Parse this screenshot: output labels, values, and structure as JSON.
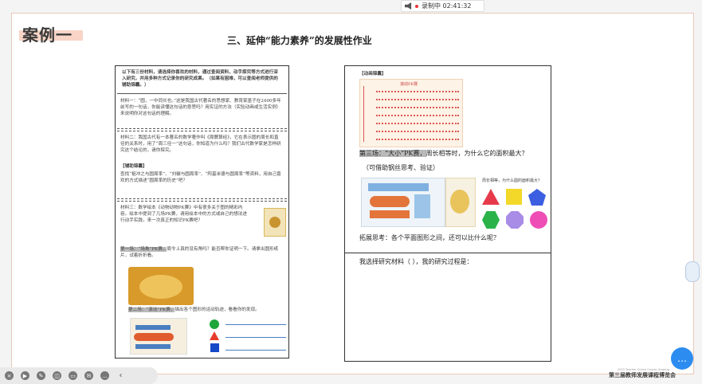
{
  "recording": {
    "label": "录制中 02:41:32"
  },
  "slide": {
    "case_title": "案例一",
    "title": "三、延伸“能力素养”的发展性作业"
  },
  "left_doc": {
    "intro": "以下有三份材料，请选择你喜欢的材料，通过查阅资料，动手探究等方式进行深入研究，并用多种方式记录你的研究成果。（如果有困难，可以查阅老师提供的辅助锦囊。）",
    "m1": "材料一：“圆，一中同长也。”这是我国古代著名的思想家、教育家墨子在2400多年前写的一句话，你能读懂这句话的意思吗？用实证的方法（实验动画或生活实例）来说明你对这句话的理解。",
    "m2": "材料二：我国古代有一本著名的数学著作叫《周髀算经》，它在表示圆的周长和直径的关系时，用了“周三径一”这句话，你知道为什么吗？我们古代数学家是怎样研究这个结论的，请你探究。",
    "tip_head": "【辅助锦囊】",
    "tip": "查找“祖冲之与圆周率”、“刘徽与圆周率”、“阿基米德与圆周率”等资料，用自己喜欢的方式描述“圆周率的历史”吧？",
    "m3": "材料三：数学绘本《动物动物PK赛》中有很多关于图的精彩内容。绘本中提到了几场PK赛，请用绘本中的方式或自己的想法进行动手实践，来一次真正的知识PK赛吧？",
    "s1": "第一场：“场角”PK赛，",
    "s1_rest": "周令上真的没有角吗？能否帮你证明一下。请拿出圆形纸片，试着折折看。",
    "s2": "第二场：“滚动”PK赛，",
    "s2_rest": "描出各个图形的运动轨迹，看看你的发现。"
  },
  "right_doc": {
    "tip_head": "【动画锦囊】",
    "s3": "第三场：“大小”PK赛，",
    "s3_rest": "周长相等时，为什么它的面积最大？",
    "s3_hint": "（可借助钢丝思考、验证）",
    "extend": "拓展思考：各个平面图形之间，还可以比什么呢？",
    "choose": "我选择研究材料（       ），我的研究过程是：",
    "shapes_caption": "周长相等，为什么圆的面积最大？",
    "anim_title": "滚动PK赛"
  },
  "brand": {
    "name": "第三届教师发展课程博览会",
    "sub": "2023 Teacher Online Course Growing"
  },
  "colors": {
    "accent": "#f3b9a2",
    "chat": "#2d8cf0"
  }
}
